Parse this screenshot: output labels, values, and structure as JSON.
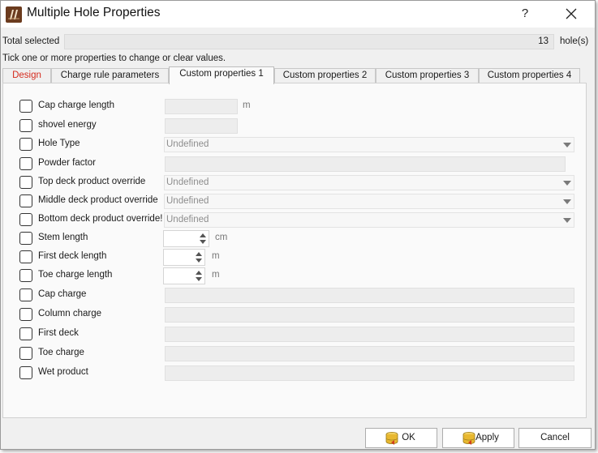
{
  "window": {
    "title": "Multiple Hole Properties",
    "help": "?"
  },
  "selection": {
    "label": "Total selected",
    "count": "13",
    "unit": "hole(s)",
    "hint": "Tick one or more properties to change or clear values."
  },
  "tabs": [
    {
      "label": "Design",
      "active": false
    },
    {
      "label": "Charge rule parameters",
      "active": false
    },
    {
      "label": "Custom properties 1",
      "active": true
    },
    {
      "label": "Custom properties 2",
      "active": false
    },
    {
      "label": "Custom properties 3",
      "active": false
    },
    {
      "label": "Custom properties 4",
      "active": false
    }
  ],
  "properties": [
    {
      "label": "Cap charge length",
      "kind": "text-short",
      "value": "",
      "unit": "m"
    },
    {
      "label": "shovel energy",
      "kind": "text-short",
      "value": ""
    },
    {
      "label": "Hole Type",
      "kind": "combo",
      "value": "Undefined"
    },
    {
      "label": "Powder factor",
      "kind": "text-long",
      "value": ""
    },
    {
      "label": "Top deck product override",
      "kind": "combo",
      "value": "Undefined"
    },
    {
      "label": "Middle deck product override",
      "kind": "combo",
      "value": "Undefined"
    },
    {
      "label": "Bottom deck product override!",
      "kind": "combo",
      "value": "Undefined"
    },
    {
      "label": "Stem length",
      "kind": "spin",
      "value": "",
      "unit": "cm"
    },
    {
      "label": "First deck length",
      "kind": "spin",
      "value": "",
      "unit": "m"
    },
    {
      "label": "Toe charge length",
      "kind": "spin",
      "value": "",
      "unit": "m"
    },
    {
      "label": "Cap charge",
      "kind": "text-long",
      "value": ""
    },
    {
      "label": "Column charge",
      "kind": "text-long",
      "value": ""
    },
    {
      "label": "First deck",
      "kind": "text-long",
      "value": ""
    },
    {
      "label": "Toe charge",
      "kind": "text-long",
      "value": ""
    },
    {
      "label": "Wet product",
      "kind": "text-long",
      "value": ""
    }
  ],
  "buttons": {
    "ok": "OK",
    "apply": "Apply",
    "cancel": "Cancel"
  },
  "colors": {
    "design_tab_text": "#d52b1e",
    "app_icon": "#6b3b1e",
    "button_icon": "#e8b830"
  },
  "icons": {
    "app": "explosive-app-icon",
    "ok": "database-check-icon",
    "apply": "database-apply-icon",
    "close": "close-icon"
  }
}
